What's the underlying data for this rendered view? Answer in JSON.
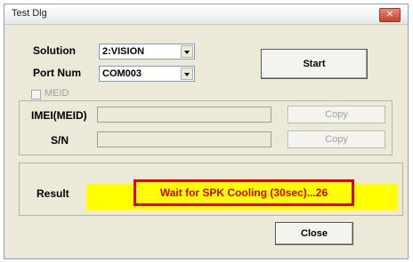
{
  "window": {
    "title": "Test Dlg",
    "close_glyph": "✕"
  },
  "form": {
    "solution_label": "Solution",
    "solution_value": "2:VISION",
    "port_label": "Port Num",
    "port_value": "COM003",
    "meid_label": "MEID",
    "imei_label": "IMEI(MEID)",
    "sn_label": "S/N",
    "imei_value": "",
    "sn_value": ""
  },
  "buttons": {
    "start": "Start",
    "copy_imei": "Copy",
    "copy_sn": "Copy",
    "close": "Close"
  },
  "result": {
    "label": "Result",
    "message": "Wait for SPK Cooling (30sec)...26"
  },
  "colors": {
    "result_bg": "#ffff00",
    "highlight_border": "#e10000",
    "result_text": "#d00000"
  }
}
